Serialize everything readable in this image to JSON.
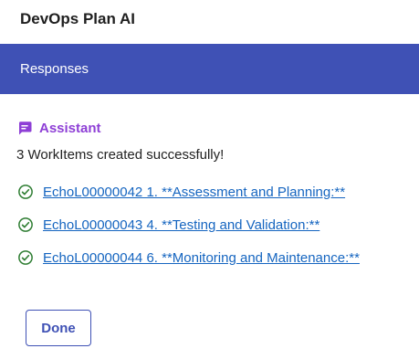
{
  "app": {
    "title": "DevOps Plan AI"
  },
  "header": {
    "responses_label": "Responses",
    "accent_color": "#3f51b5"
  },
  "assistant": {
    "label": "Assistant",
    "icon": "chat-bubble-icon",
    "color": "#8e3fd6"
  },
  "message": {
    "status": "3 WorkItems created successfully!"
  },
  "workitems": [
    {
      "label": "EchoL00000042 1. **Assessment and Planning:**",
      "icon": "check-circle-icon"
    },
    {
      "label": "EchoL00000043 4. **Testing and Validation:**",
      "icon": "check-circle-icon"
    },
    {
      "label": "EchoL00000044 6. **Monitoring and Maintenance:**",
      "icon": "check-circle-icon"
    }
  ],
  "actions": {
    "done_label": "Done"
  }
}
